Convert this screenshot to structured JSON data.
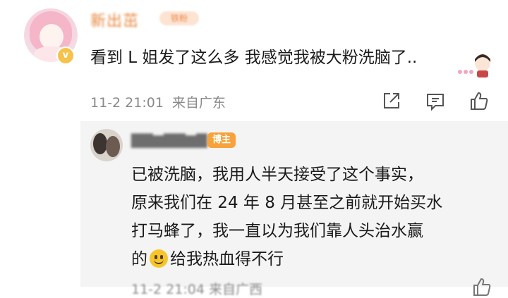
{
  "main_comment": {
    "username": "新出茁",
    "fan_tag": "铁粉",
    "text": "看到 L 姐发了这么多 我感觉我被大粉洗脑了..",
    "date": "11-2 21:01",
    "location": "来自广东",
    "actions": {
      "share_icon": "share-icon",
      "comment_icon": "comment-icon",
      "like_icon": "like-icon"
    }
  },
  "reply": {
    "username": "",
    "author_tag": "博主",
    "lines": [
      "已被洗脑，我用人半天接受了这个事实，",
      "原来我们在 24 年 8 月甚至之前就开始买水",
      "打马蜂了，我一直以为我们靠人头治水赢",
      "的",
      "给我热血得不行"
    ],
    "emoji": "smile-emoji",
    "meta": "11-2 21:04 来自广西"
  },
  "colors": {
    "username": "#e8863b",
    "author_tag_bg": "#f7a23b",
    "meta_text": "#8a8a8a",
    "reply_bg": "#f4f4f4"
  }
}
